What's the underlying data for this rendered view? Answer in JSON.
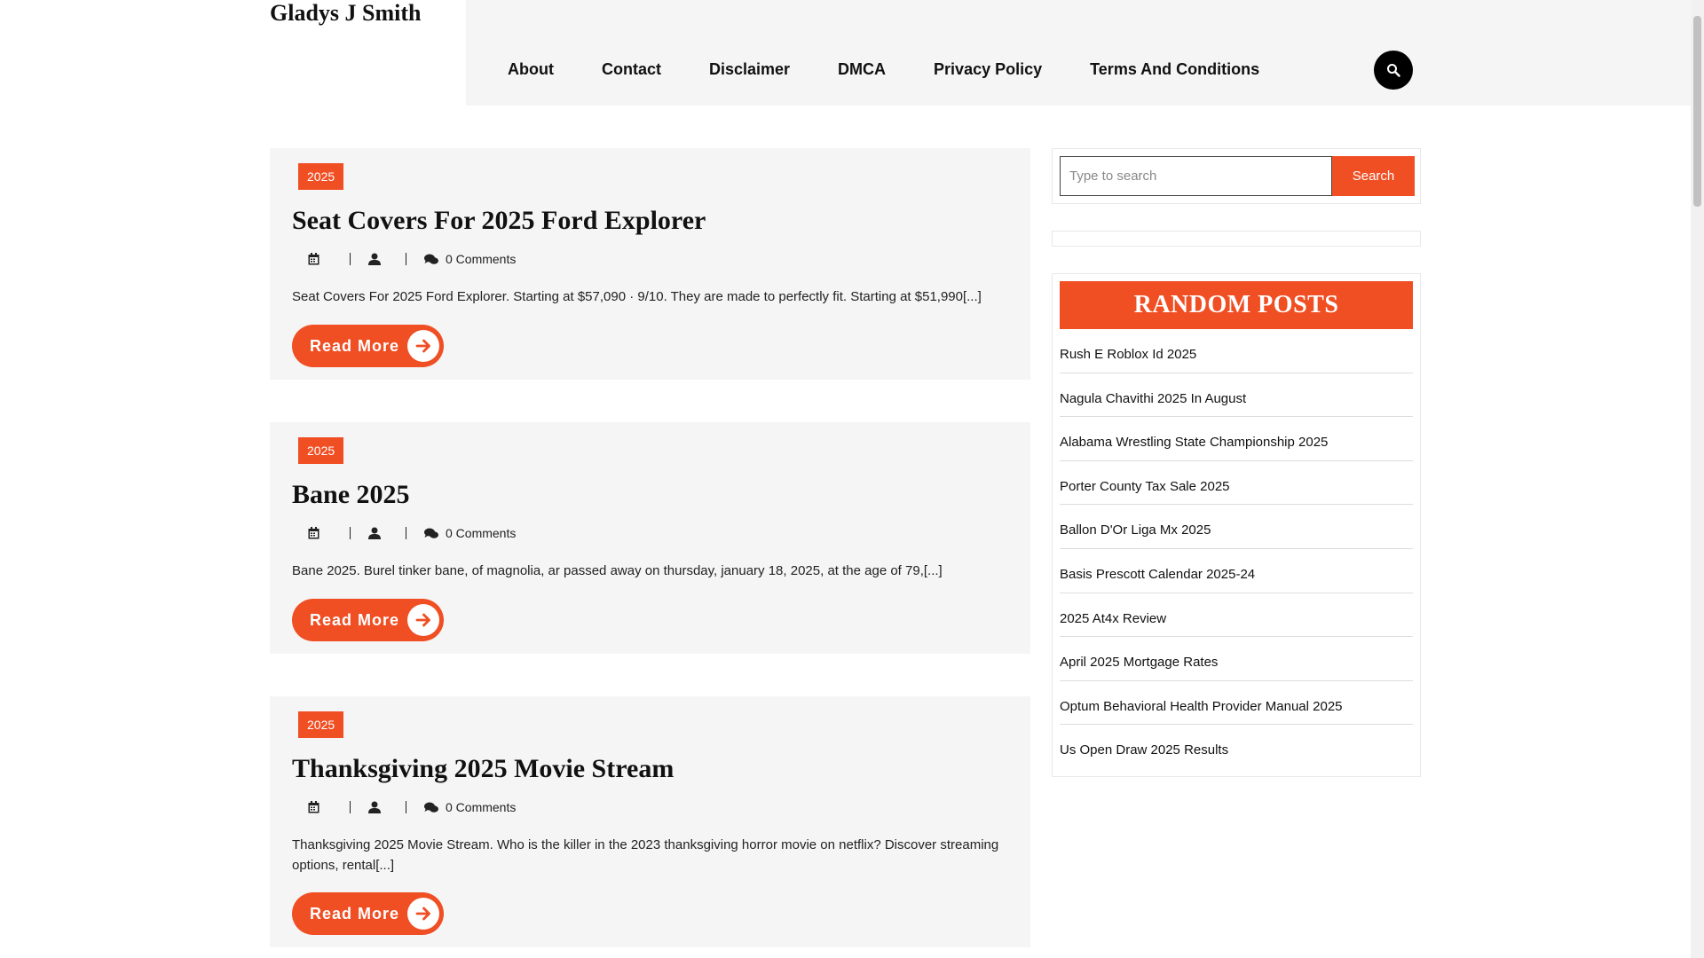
{
  "site": {
    "title": "Gladys J Smith"
  },
  "nav": {
    "items": [
      {
        "label": "About"
      },
      {
        "label": "Contact"
      },
      {
        "label": "Disclaimer"
      },
      {
        "label": "DMCA"
      },
      {
        "label": "Privacy Policy"
      },
      {
        "label": "Terms And Conditions"
      }
    ]
  },
  "posts": [
    {
      "category": "2025",
      "title": "Seat Covers For 2025 Ford Explorer",
      "comments": "0 Comments",
      "excerpt": "Seat Covers For 2025 Ford Explorer. Starting at $57,090 · 9/10. They are made to perfectly fit. Starting at $51,990[...]",
      "read_more": "Read More"
    },
    {
      "category": "2025",
      "title": "Bane 2025",
      "comments": "0 Comments",
      "excerpt": "Bane 2025. Burel tinker bane, of magnolia, ar passed away on thursday, january 18, 2025, at the age of 79,[...]",
      "read_more": "Read More"
    },
    {
      "category": "2025",
      "title": "Thanksgiving 2025 Movie Stream",
      "comments": "0 Comments",
      "excerpt": "Thanksgiving 2025 Movie Stream. Who is the killer in the 2023 thanksgiving horror movie on netflix? Discover streaming options, rental[...]",
      "read_more": "Read More"
    }
  ],
  "sidebar": {
    "search": {
      "placeholder": "Type to search",
      "button": "Search"
    },
    "random_posts": {
      "heading": "RANDOM POSTS",
      "items": [
        "Rush E Roblox Id 2025",
        "Nagula Chavithi 2025 In August",
        "Alabama Wrestling State Championship 2025",
        "Porter County Tax Sale 2025",
        "Ballon D'Or Liga Mx 2025",
        "Basis Prescott Calendar 2025-24",
        "2025 At4x Review",
        "April 2025 Mortgage Rates",
        "Optum Behavioral Health Provider Manual 2025",
        "Us Open Draw 2025 Results"
      ]
    }
  },
  "colors": {
    "accent": "#f04e23",
    "panel": "#f5f5f5"
  },
  "icons": [
    "search-icon",
    "calendar-icon",
    "user-icon",
    "comments-icon",
    "arrow-right-icon"
  ]
}
